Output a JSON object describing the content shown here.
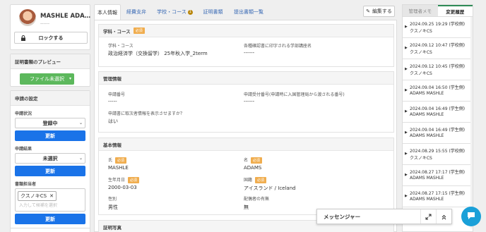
{
  "profile": {
    "name": "MASHLE ADA…",
    "sub": "------",
    "lock_label": "ロックする"
  },
  "preview": {
    "title": "証明書類のプレビュー",
    "button": "ファイル未選択"
  },
  "settings": {
    "title": "申請の設定",
    "status_label": "申請状況",
    "status_value": "登録中",
    "result_label": "申請結果",
    "result_value": "未選択",
    "assignee_label": "書類担当者",
    "assignee_tag": "クスノキCS",
    "assignee_placeholder": "入力して候補を選択",
    "update": "更新"
  },
  "tabs": [
    {
      "label": "本人情報"
    },
    {
      "label": "経費支弁"
    },
    {
      "label": "学校・コース",
      "badge": "1"
    },
    {
      "label": "証明書類"
    },
    {
      "label": "提出書類一覧"
    }
  ],
  "edit_label": "編集する",
  "required": "必須",
  "school": {
    "title": "学科・コース",
    "course_label": "学科・コース",
    "course_value": "政治経済学（交換留学） 25年秋入学_2term",
    "doc_name_label": "各種確認書に印字される学部講座名",
    "doc_name_value": "------"
  },
  "mgmt": {
    "title": "管理情報",
    "app_no_label": "申請番号",
    "app_no_value": "-----",
    "receipt_label": "申請受付番号(申請時に入国管理局から渡される番号)",
    "receipt_value": "------",
    "cancel_label": "申請書に取次者情報を表示させますか？",
    "cancel_value": "はい"
  },
  "basic": {
    "title": "基本情報",
    "last_label": "氏",
    "last_value": "MASHLE",
    "first_label": "名",
    "first_value": "ADAMS",
    "birth_label": "生年月日",
    "birth_value": "2000-03-03",
    "nation_label": "国籍",
    "nation_value": "アイスランド / Iceland",
    "sex_label": "性別",
    "sex_value": "男性",
    "spouse_label": "配偶者の有無",
    "spouse_value": "無"
  },
  "photo": {
    "title": "証明写真"
  },
  "right": {
    "memo_tab": "管理者メモ",
    "hist_tab": "変更履歴",
    "items": [
      {
        "l1": "2024.09.25 19:29 (学校側)",
        "l2": "クスノキCS"
      },
      {
        "l1": "2024.09.12 10:47 (学校側)",
        "l2": "クスノキCS"
      },
      {
        "l1": "2024.09.12 10:45 (学校側)",
        "l2": "クスノキCS"
      },
      {
        "l1": "2024.09.04 16:50 (学生側)",
        "l2": "ADAMS MASHLE"
      },
      {
        "l1": "2024.09.04 16:49 (学生側)",
        "l2": "ADAMS MASHLE"
      },
      {
        "l1": "2024.09.04 16:49 (学生側)",
        "l2": "ADAMS MASHLE"
      },
      {
        "l1": "2024.08.29 15:55 (学校側)",
        "l2": "クスノキCS"
      },
      {
        "l1": "2024.08.27 17:17 (学生側)",
        "l2": "ADAMS MASHLE"
      },
      {
        "l1": "2024.08.27 17:15 (学生側)",
        "l2": "ADAMS MASHLE"
      }
    ]
  },
  "messenger": {
    "title": "メッセンジャー"
  },
  "colors": {
    "accent": "#1a73e8",
    "green": "#5cb85c",
    "required": "#f0ad4e",
    "chat": "#1aa0d8"
  }
}
